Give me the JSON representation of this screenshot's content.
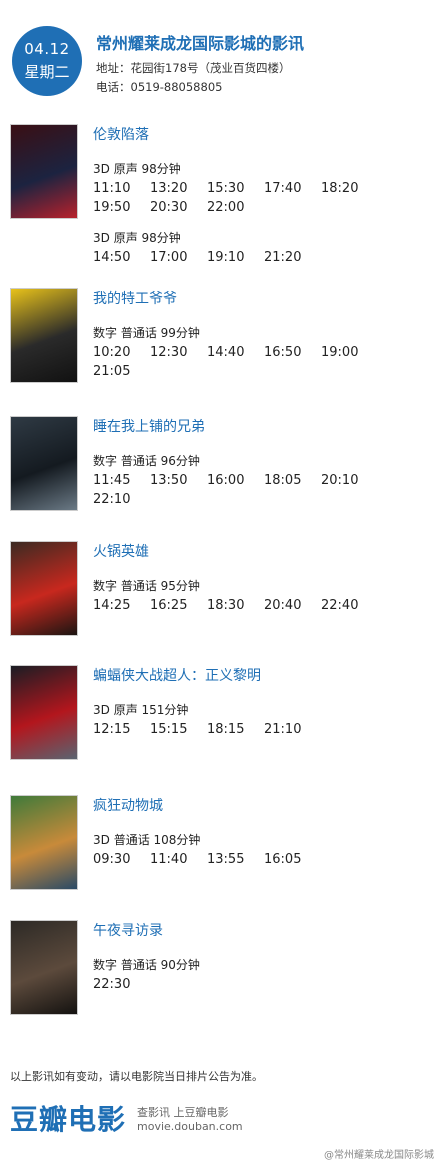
{
  "header": {
    "date": "04.12",
    "weekday": "星期二",
    "cinema": "常州耀莱成龙国际影城的影讯",
    "address": "地址：花园街178号（茂业百货四楼）",
    "phone": "电话：0519-88058805"
  },
  "movies": [
    {
      "title": "伦敦陷落",
      "poster_colors": [
        "#3a0f14",
        "#1c2340",
        "#b8222c"
      ],
      "sessions": [
        {
          "format": "3D 原声 98分钟",
          "times": [
            "11:10",
            "13:20",
            "15:30",
            "17:40",
            "18:20",
            "19:50",
            "20:30",
            "22:00"
          ]
        },
        {
          "format": "3D 原声 98分钟",
          "times": [
            "14:50",
            "17:00",
            "19:10",
            "21:20"
          ]
        }
      ]
    },
    {
      "title": "我的特工爷爷",
      "poster_colors": [
        "#e8c21a",
        "#2a2a2a",
        "#111111"
      ],
      "sessions": [
        {
          "format": "数字 普通话 99分钟",
          "times": [
            "10:20",
            "12:30",
            "14:40",
            "16:50",
            "19:00",
            "21:05"
          ]
        }
      ]
    },
    {
      "title": "睡在我上铺的兄弟",
      "poster_colors": [
        "#2f3a44",
        "#141a20",
        "#6b7a86"
      ],
      "sessions": [
        {
          "format": "数字 普通话 96分钟",
          "times": [
            "11:45",
            "13:50",
            "16:00",
            "18:05",
            "20:10",
            "22:10"
          ]
        }
      ]
    },
    {
      "title": "火锅英雄",
      "poster_colors": [
        "#3b2a22",
        "#c8281e",
        "#1b1512"
      ],
      "sessions": [
        {
          "format": "数字 普通话 95分钟",
          "times": [
            "14:25",
            "16:25",
            "18:30",
            "20:40",
            "22:40"
          ]
        }
      ]
    },
    {
      "title": "蝙蝠侠大战超人：正义黎明",
      "poster_colors": [
        "#1a1d24",
        "#b3161d",
        "#5a6470"
      ],
      "sessions": [
        {
          "format": "3D 原声 151分钟",
          "times": [
            "12:15",
            "15:15",
            "18:15",
            "21:10"
          ]
        }
      ]
    },
    {
      "title": "疯狂动物城",
      "poster_colors": [
        "#3f7a3a",
        "#c88a3a",
        "#2a4a66"
      ],
      "sessions": [
        {
          "format": "3D 普通话 108分钟",
          "times": [
            "09:30",
            "11:40",
            "13:55",
            "16:05"
          ]
        }
      ]
    },
    {
      "title": "午夜寻访录",
      "poster_colors": [
        "#2d2a26",
        "#5c4a3c",
        "#141210"
      ],
      "sessions": [
        {
          "format": "数字 普通话 90分钟",
          "times": [
            "22:30"
          ]
        }
      ]
    }
  ],
  "footer": {
    "note": "以上影讯如有变动，请以电影院当日排片公告为准。",
    "brand": "豆瓣电影",
    "brand_sub": "查影讯 上豆瓣电影",
    "url": "movie.douban.com",
    "watermark": "@常州耀莱成龙国际影城"
  },
  "colors": {
    "accent": "#1f6fb5"
  }
}
